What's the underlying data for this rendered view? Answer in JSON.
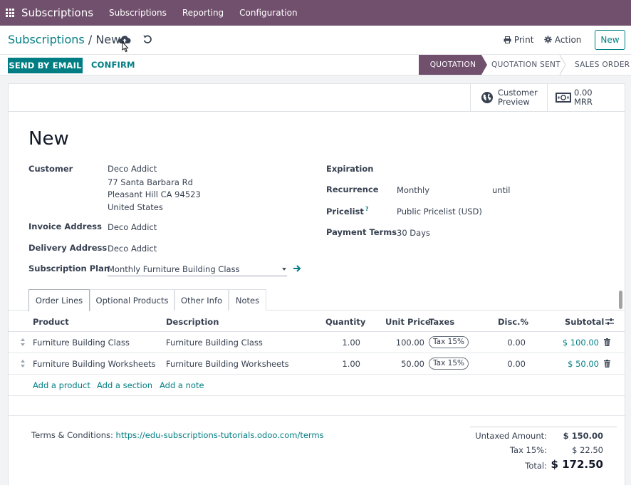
{
  "navbar": {
    "brand": "Subscriptions",
    "menu": [
      "Subscriptions",
      "Reporting",
      "Configuration"
    ],
    "bg_color": "#71506d"
  },
  "control": {
    "breadcrumb_parent": "Subscriptions",
    "breadcrumb_sep": "/",
    "breadcrumb_current": "New",
    "print_label": "Print",
    "action_label": "Action",
    "new_label": "New"
  },
  "statusbar": {
    "send_email_label": "SEND BY EMAIL",
    "confirm_label": "CONFIRM",
    "stages": [
      "QUOTATION",
      "QUOTATION SENT",
      "SALES ORDER"
    ],
    "active_stage": "QUOTATION"
  },
  "smart_buttons": {
    "preview_line1": "Customer",
    "preview_line2": "Preview",
    "mrr_value": "0.00",
    "mrr_label": "MRR"
  },
  "record": {
    "title": "New",
    "customer_label": "Customer",
    "customer_name": "Deco Addict",
    "customer_street": "77 Santa Barbara Rd",
    "customer_city": "Pleasant Hill CA 94523",
    "customer_country": "United States",
    "invoice_address_label": "Invoice Address",
    "invoice_address": "Deco Addict",
    "delivery_address_label": "Delivery Address",
    "delivery_address": "Deco Addict",
    "plan_label": "Subscription Plan",
    "plan_value": "Monthly Furniture Building Class",
    "expiration_label": "Expiration",
    "recurrence_label": "Recurrence",
    "recurrence_value": "Monthly",
    "recurrence_until": "until",
    "pricelist_label": "Pricelist",
    "pricelist_help": "?",
    "pricelist_value": "Public Pricelist (USD)",
    "payment_terms_label": "Payment Terms",
    "payment_terms_value": "30 Days"
  },
  "tabs": [
    "Order Lines",
    "Optional Products",
    "Other Info",
    "Notes"
  ],
  "table": {
    "headers": {
      "product": "Product",
      "description": "Description",
      "quantity": "Quantity",
      "unit_price": "Unit Price",
      "taxes": "Taxes",
      "discount": "Disc.%",
      "subtotal": "Subtotal"
    },
    "rows": [
      {
        "product": "Furniture Building Class",
        "description": "Furniture Building Class",
        "quantity": "1.00",
        "unit_price": "100.00",
        "tax": "Tax 15%",
        "discount": "0.00",
        "subtotal": "$ 100.00"
      },
      {
        "product": "Furniture Building Worksheets",
        "description": "Furniture Building Worksheets",
        "quantity": "1.00",
        "unit_price": "50.00",
        "tax": "Tax 15%",
        "discount": "0.00",
        "subtotal": "$ 50.00"
      }
    ],
    "add_product": "Add a product",
    "add_section": "Add a section",
    "add_note": "Add a note"
  },
  "footer": {
    "terms_label": "Terms & Conditions:",
    "terms_link": "https://edu-subscriptions-tutorials.odoo.com/terms",
    "untaxed_label": "Untaxed Amount:",
    "untaxed_value": "$ 150.00",
    "tax_label": "Tax 15%:",
    "tax_value": "$ 22.50",
    "total_label": "Total:",
    "total_value": "$ 172.50"
  },
  "colors": {
    "accent": "#017e84",
    "brand": "#71506d"
  }
}
